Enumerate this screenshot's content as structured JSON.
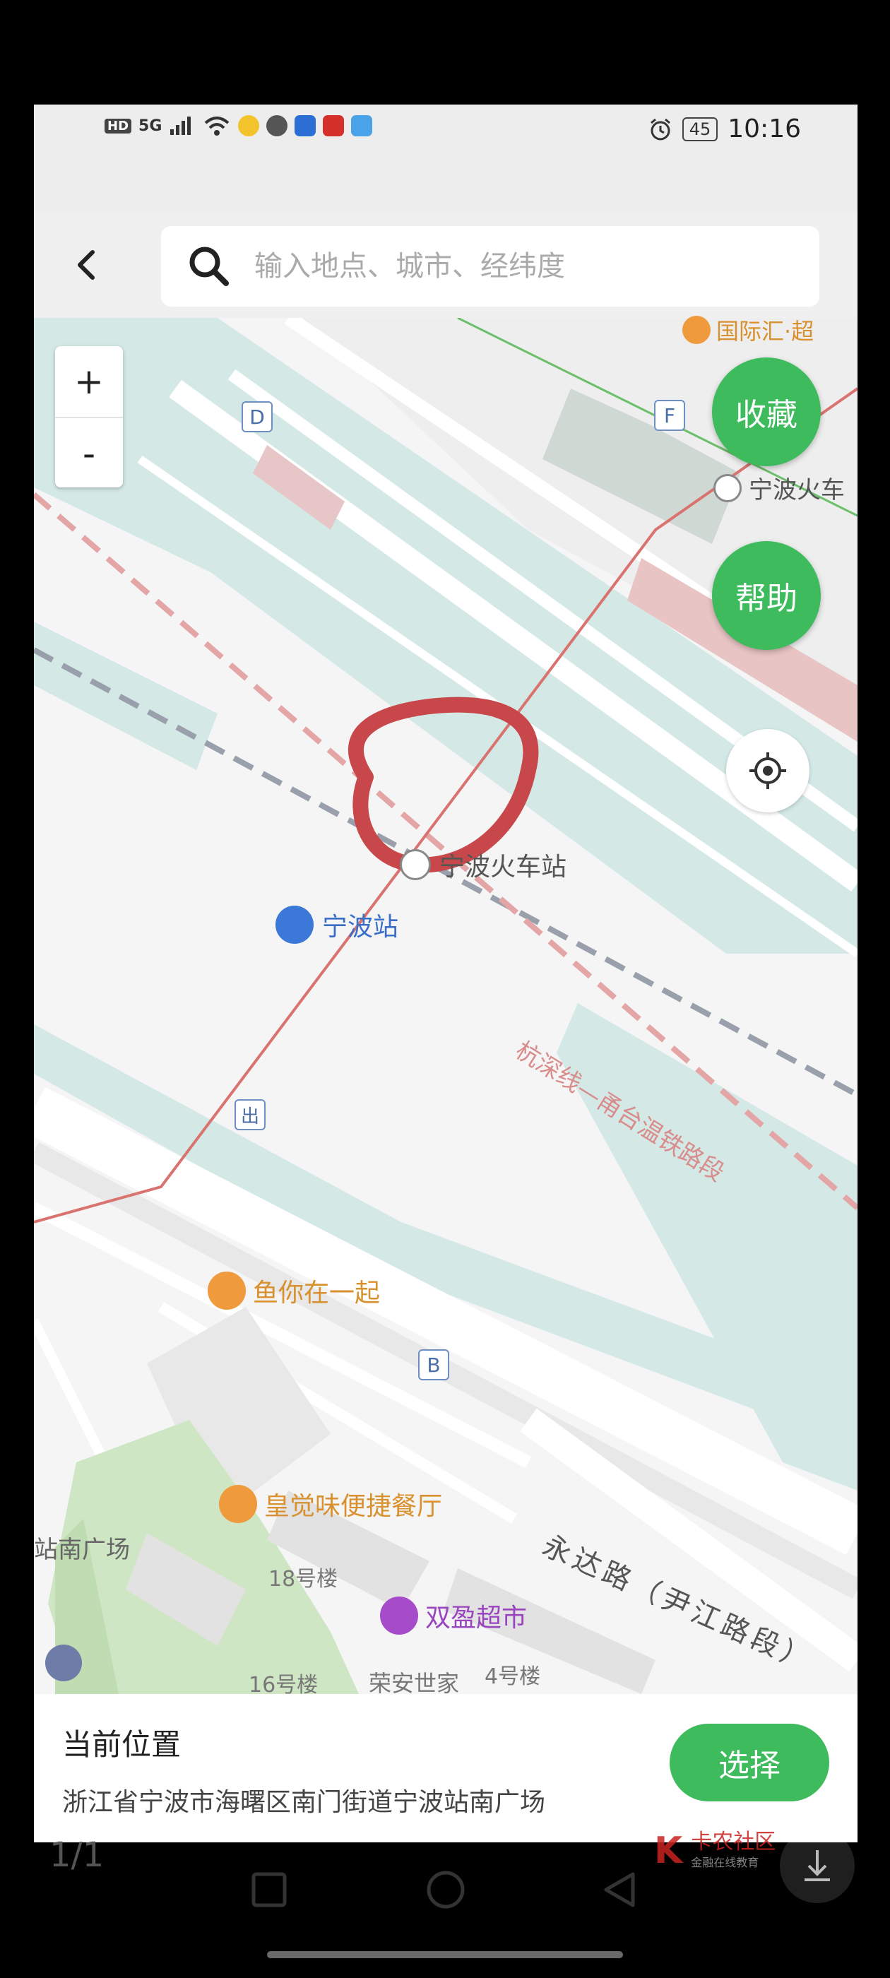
{
  "status_bar": {
    "network_badge": "HD",
    "signal": "5G",
    "battery": "45",
    "time": "10:16"
  },
  "search": {
    "placeholder": "输入地点、城市、经纬度"
  },
  "map": {
    "zoom_in_label": "+",
    "zoom_out_label": "-",
    "collect_label": "收藏",
    "help_label": "帮助",
    "labels": {
      "top_poi_partial": "国际汇·超",
      "station_topright": "宁波火车",
      "station_center": "宁波火车站",
      "ningbo_station": "宁波站",
      "exit_label": "出",
      "rail_line": "杭深线—甬台温铁路段",
      "restaurant1": "鱼你在一起",
      "restaurant2": "皇觉味便捷餐厅",
      "south_square": "站南广场",
      "bldg18": "18号楼",
      "supermarket": "双盈超市",
      "road": "永达路（尹江路段）",
      "bldg16": "16号楼",
      "bldg4": "4号楼",
      "rongan": "荣安世家",
      "gate_d": "D",
      "gate_f": "F",
      "gate_b": "B"
    }
  },
  "location_panel": {
    "title": "当前位置",
    "address": "浙江省宁波市海曙区南门街道宁波站南广场",
    "select_label": "选择"
  },
  "system": {
    "page_indicator": "1/1",
    "watermark_brand": "卡农社区",
    "watermark_sub": "金融在线教育"
  },
  "colors": {
    "accent_green": "#3dbb5d",
    "map_water": "#d4e9e6",
    "rail_line_red": "#d9736f",
    "annotation_red": "#c8474a"
  }
}
